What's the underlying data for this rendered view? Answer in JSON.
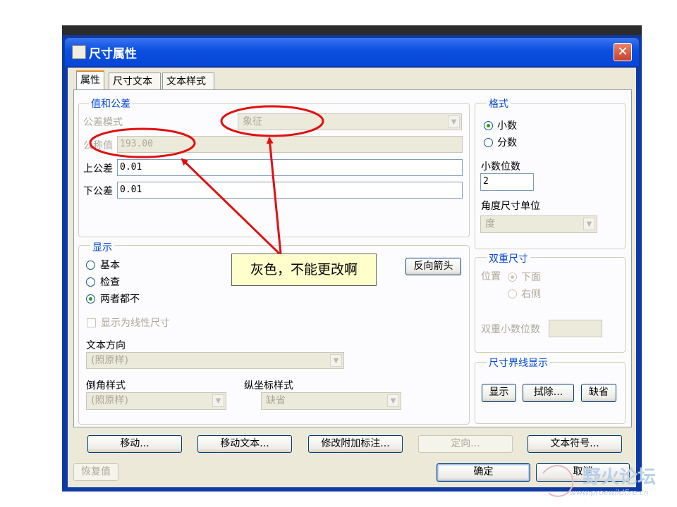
{
  "window": {
    "title": "尺寸属性",
    "close_glyph": "✕"
  },
  "tabs": [
    "属性",
    "尺寸文本",
    "文本样式"
  ],
  "value_tolerance": {
    "title": "值和公差",
    "tolerance_mode_label": "公差模式",
    "tolerance_mode_value": "象征",
    "nominal_label": "公称值",
    "nominal_value": "193.00",
    "upper_label": "上公差",
    "upper_value": "0.01",
    "lower_label": "下公差",
    "lower_value": "0.01"
  },
  "format": {
    "title": "格式",
    "decimal_label": "小数",
    "fraction_label": "分数",
    "decimal_places_label": "小数位数",
    "decimal_places_value": "2",
    "angle_unit_label": "角度尺寸单位",
    "angle_unit_value": "度"
  },
  "display": {
    "title": "显示",
    "basic_label": "基本",
    "inspect_label": "检查",
    "neither_label": "两者都不",
    "reverse_arrow_label": "反向箭头",
    "linear_checkbox_label": "显示为线性尺寸",
    "text_direction_label": "文本方向",
    "text_direction_value": "(照原样)",
    "chamfer_label": "倒角样式",
    "chamfer_value": "(照原样)",
    "ordinate_label": "纵坐标样式",
    "ordinate_value": "缺省"
  },
  "dual": {
    "title": "双重尺寸",
    "position_label": "位置",
    "below_label": "下面",
    "right_label": "右侧",
    "dual_decimal_label": "双重小数位数"
  },
  "witness": {
    "title": "尺寸界线显示",
    "show_label": "显示",
    "erase_label": "拭除...",
    "default_label": "缺省"
  },
  "bottom_buttons": {
    "move": "移动...",
    "move_text": "移动文本...",
    "modify_note": "修改附加标注...",
    "orient": "定向...",
    "text_symbol": "文本符号..."
  },
  "footer": {
    "restore": "恢复值",
    "ok": "确定",
    "cancel": "取消"
  },
  "annotation": {
    "text": "灰色，不能更改啊"
  },
  "watermark": {
    "text": "野火论坛",
    "url": "www.proewildfire.cn"
  },
  "colors": {
    "title_bar": "#0a4fe0",
    "group_title": "#0046d5",
    "annotation_red": "#e01010",
    "callout_bg": "#ffffcc"
  }
}
